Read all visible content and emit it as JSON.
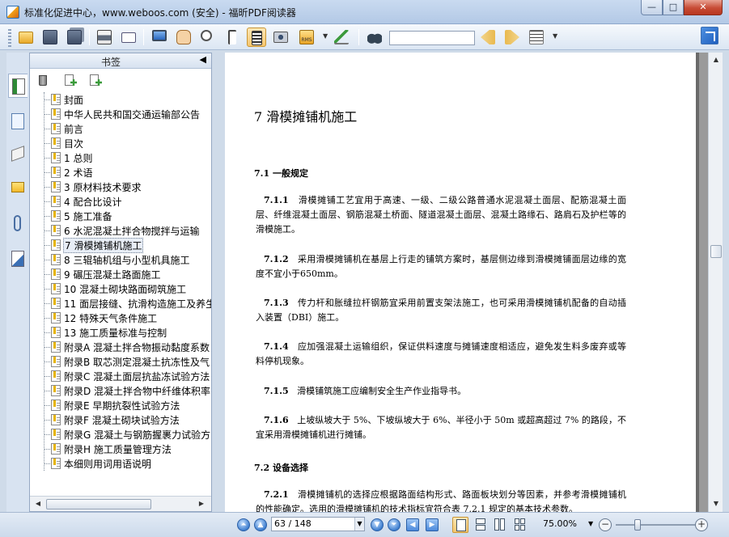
{
  "window": {
    "title": "标准化促进中心，www.weboos.com (安全) - 福昕PDF阅读器",
    "minimize_label": "—",
    "maximize_label": "□",
    "close_label": "✕"
  },
  "toolbar": {
    "search_value": "",
    "tools": [
      "open-icon",
      "save-icon",
      "save-as-icon",
      "print-icon",
      "email-icon",
      "fullscreen-icon",
      "hand-icon",
      "zoom-icon",
      "select-icon",
      "text-select-icon",
      "snapshot-icon",
      "rms-icon",
      "sign-icon",
      "find-icon",
      "find-prev-icon",
      "find-next-icon",
      "find-options-icon"
    ],
    "rms_label": "RMS"
  },
  "sidebar": {
    "panel_title": "书签",
    "bookmarks": [
      {
        "label": "封面"
      },
      {
        "label": "中华人民共和国交通运输部公告"
      },
      {
        "label": "前言"
      },
      {
        "label": "目次"
      },
      {
        "label": "1 总则"
      },
      {
        "label": "2 术语"
      },
      {
        "label": "3 原材料技术要求"
      },
      {
        "label": "4 配合比设计"
      },
      {
        "label": "5 施工准备"
      },
      {
        "label": "6 水泥混凝土拌合物搅拌与运输"
      },
      {
        "label": "7 滑模摊铺机施工"
      },
      {
        "label": "8 三辊轴机组与小型机具施工"
      },
      {
        "label": "9 碾压混凝土路面施工"
      },
      {
        "label": "10 混凝土砌块路面砌筑施工"
      },
      {
        "label": "11 面层接缝、抗滑构造施工及养生"
      },
      {
        "label": "12 特殊天气条件施工"
      },
      {
        "label": "13 施工质量标准与控制"
      },
      {
        "label": "附录A 混凝土拌合物振动黏度系数"
      },
      {
        "label": "附录B 取芯测定混凝土抗冻性及气"
      },
      {
        "label": "附录C 混凝土面层抗盐冻试验方法"
      },
      {
        "label": "附录D 混凝土拌合物中纤维体积率"
      },
      {
        "label": "附录E 早期抗裂性试验方法"
      },
      {
        "label": "附录F 混凝土砌块试验方法"
      },
      {
        "label": "附录G 混凝土与钢筋握裹力试验方"
      },
      {
        "label": "附录H 施工质量管理方法"
      },
      {
        "label": "本细则用词用语说明"
      }
    ],
    "selected_index": 10,
    "scroll_left_label": "◀",
    "scroll_right_label": "▶",
    "collapse_label": "◀"
  },
  "document": {
    "chapter_title": "7   滑模摊铺机施工",
    "sections": [
      {
        "heading": "7.1   一般规定",
        "top": 0
      },
      {
        "heading": "7.2   设备选择",
        "top": 0
      }
    ],
    "clauses": [
      {
        "num": "7.1.1",
        "text": "滑模摊铺工艺宜用于高速、一级、二级公路普通水泥混凝土面层、配筋混凝土面层、纤维混凝土面层、钢筋混凝土桥面、隧道混凝土面层、混凝土路缘石、路肩石及护栏等的滑模施工。"
      },
      {
        "num": "7.1.2",
        "text": "采用滑模摊铺机在基层上行走的铺筑方案时，基层侧边缘到滑模摊铺面层边缘的宽度不宜小于650mm。"
      },
      {
        "num": "7.1.3",
        "text": "传力杆和胀缝拉杆钢筋宜采用前置支架法施工，也可采用滑模摊铺机配备的自动插入装置（DBI）施工。"
      },
      {
        "num": "7.1.4",
        "text": "应加强混凝土运输组织，保证供料速度与摊铺速度相适应，避免发生料多废弃或等料停机现象。"
      },
      {
        "num": "7.1.5",
        "text": "滑模铺筑施工应编制安全生产作业指导书。"
      },
      {
        "num": "7.1.6",
        "text": "上坡纵坡大于 5%、下坡纵坡大于 6%、半径小于 50m 或超高超过 7% 的路段，不宜采用滑模摊铺机进行摊铺。"
      },
      {
        "num": "7.2.1",
        "text": "滑模摊铺机的选择应根据路面结构形式、路面板块划分等因素，并参考滑模摊铺机的性能确定。选用的滑模摊铺机的技术指标宜符合表 7.2.1 规定的基本技术参数。"
      }
    ]
  },
  "statusbar": {
    "page_display": "63 / 148",
    "zoom": "75.00%",
    "zoom_slider_fraction": 0.28,
    "zoom_minus": "−",
    "zoom_plus": "+",
    "nav_first": "⏶",
    "nav_prev": "▲",
    "nav_next": "▼",
    "nav_last": "⏷",
    "back": "◀",
    "forward": "▶"
  },
  "colors": {
    "accent": "#3f7fd0",
    "chrome": "#cfdbe9",
    "doc_background": "#9a9a9a"
  }
}
